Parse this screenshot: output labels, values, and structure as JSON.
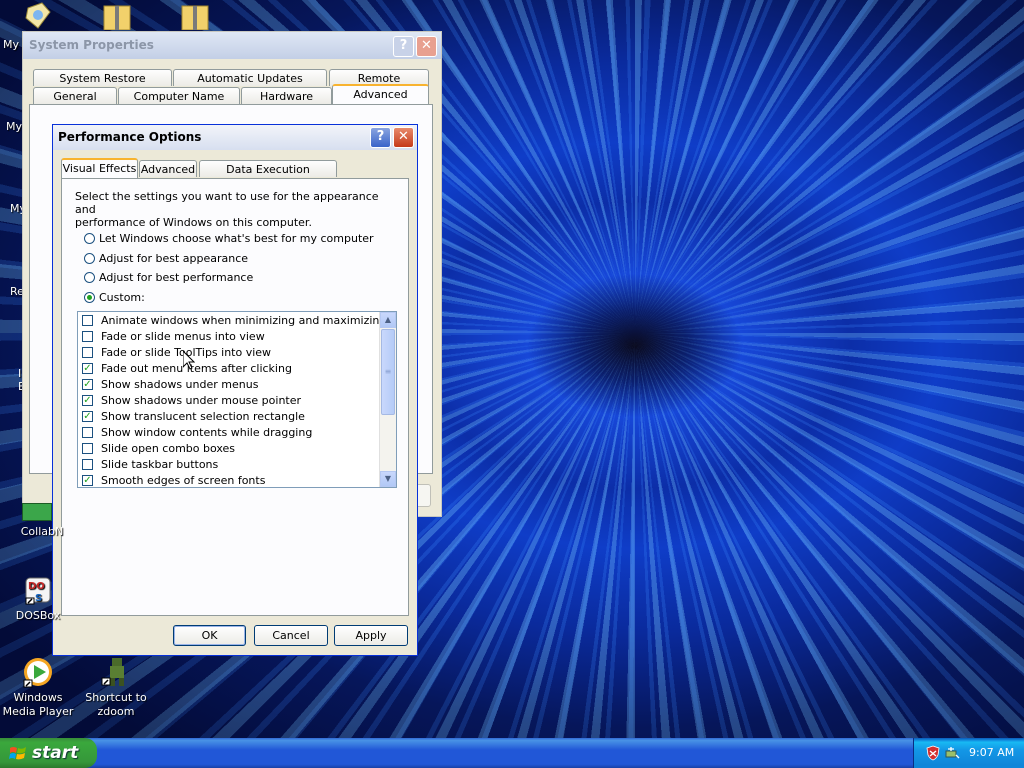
{
  "desktop": {
    "icons": [
      {
        "label": "CollabN",
        "icon": "collab-icon"
      },
      {
        "label": "DOSBox",
        "icon": "dosbox-icon"
      },
      {
        "label": "Windows Media Player",
        "icon": "media-player-icon"
      },
      {
        "label": "Shortcut to zdoom",
        "icon": "zdoom-icon"
      }
    ],
    "partial_labels": [
      "My",
      "My",
      "My",
      "Re",
      "I",
      "E"
    ]
  },
  "system_properties": {
    "title": "System Properties",
    "tabs_row1": [
      "System Restore",
      "Automatic Updates",
      "Remote"
    ],
    "tabs_row2": [
      "General",
      "Computer Name",
      "Hardware",
      "Advanced"
    ],
    "active_tab": "Advanced"
  },
  "performance_options": {
    "title": "Performance Options",
    "tabs": [
      "Visual Effects",
      "Advanced",
      "Data Execution Prevention"
    ],
    "active_tab": "Visual Effects",
    "description": "Select the settings you want to use for the appearance and performance of Windows on this computer.",
    "description_line1": "Select the settings you want to use for the appearance and",
    "description_line2": "performance of Windows on this computer.",
    "options": [
      {
        "label": "Let Windows choose what's best for my computer",
        "selected": false
      },
      {
        "label": "Adjust for best appearance",
        "selected": false
      },
      {
        "label": "Adjust for best performance",
        "selected": false
      },
      {
        "label": "Custom:",
        "selected": true
      }
    ],
    "effects": [
      {
        "label": "Animate windows when minimizing and maximizing",
        "checked": false
      },
      {
        "label": "Fade or slide menus into view",
        "checked": false
      },
      {
        "label": "Fade or slide ToolTips into view",
        "checked": false
      },
      {
        "label": "Fade out menu items after clicking",
        "checked": true
      },
      {
        "label": "Show shadows under menus",
        "checked": true
      },
      {
        "label": "Show shadows under mouse pointer",
        "checked": true
      },
      {
        "label": "Show translucent selection rectangle",
        "checked": true
      },
      {
        "label": "Show window contents while dragging",
        "checked": false
      },
      {
        "label": "Slide open combo boxes",
        "checked": false
      },
      {
        "label": "Slide taskbar buttons",
        "checked": false
      },
      {
        "label": "Smooth edges of screen fonts",
        "checked": true
      }
    ],
    "buttons": {
      "ok": "OK",
      "cancel": "Cancel",
      "apply": "Apply"
    }
  },
  "taskbar": {
    "start_label": "start",
    "clock": "9:07 AM"
  },
  "colors": {
    "xp_blue": "#0831d9",
    "start_green": "#3aa83c",
    "tab_highlight": "#f8b32f",
    "check_green": "#21a121"
  }
}
